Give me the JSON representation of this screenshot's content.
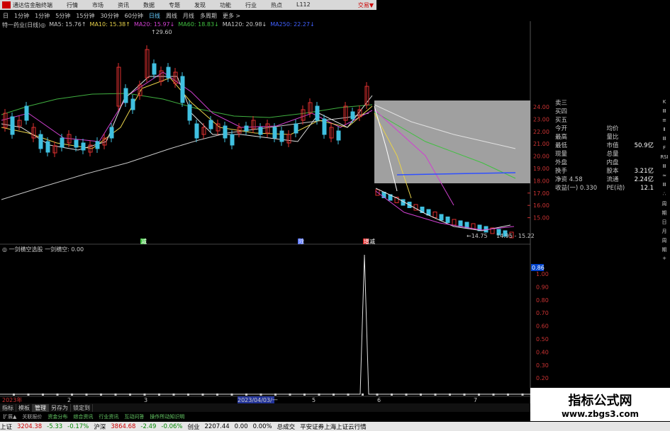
{
  "titlebar": {
    "app": "通达信金融终端",
    "menus": [
      "行情",
      "市场",
      "资讯",
      "数据",
      "专题",
      "发现",
      "功能",
      "行业",
      "热点",
      "L112"
    ],
    "right": "交易▼"
  },
  "periods": [
    "日",
    "1分钟",
    "1分钟",
    "5分钟",
    "15分钟",
    "30分钟",
    "60分钟",
    "日线",
    "周线",
    "月线",
    "多周期",
    "更多 >"
  ],
  "ma_legend": [
    {
      "text": "特一药业(日线)◎",
      "color": "#c8c8c8"
    },
    {
      "text": "MA5: 15.76↑",
      "color": "#c8c8c8"
    },
    {
      "text": "MA10: 15.38↑",
      "color": "#e8d24a"
    },
    {
      "text": "MA20: 15.97↓",
      "color": "#d040d0"
    },
    {
      "text": "MA60: 18.83↓",
      "color": "#40c040"
    },
    {
      "text": "MA120: 20.98↓",
      "color": "#c8c8c8"
    },
    {
      "text": "MA250: 22.27↓",
      "color": "#4060ff"
    }
  ],
  "chart": {
    "high_label": "29.60",
    "low_label": "14.75",
    "last_labels": "14.95 - 15.22",
    "price_ticks": [
      "24.00",
      "23.00",
      "22.00",
      "21.00",
      "20.00",
      "19.00",
      "18.00",
      "17.00",
      "16.00",
      "15.00"
    ],
    "osc_ticks": [
      "1.00",
      "0.90",
      "0.80",
      "0.70",
      "0.60",
      "0.50",
      "0.40",
      "0.30",
      "0.20",
      "0.10"
    ],
    "osc_marker": "0.86",
    "date_labels": [
      "2023年",
      "2",
      "3",
      "2023/04/03/一",
      "5",
      "6",
      "7"
    ],
    "bottom_markers": [
      "减",
      "除",
      "增减"
    ]
  },
  "info": [
    [
      "卖三",
      "",
      ""
    ],
    [
      "买四",
      "",
      ""
    ],
    [
      "买五",
      "",
      ""
    ],
    [
      "今开",
      "均价",
      ""
    ],
    [
      "最高",
      "量比",
      ""
    ],
    [
      "最低",
      "市值",
      "50.9亿"
    ],
    [
      "现量",
      "总量",
      ""
    ],
    [
      "外盘",
      "内盘",
      ""
    ],
    [
      "换手",
      "股本",
      "3.21亿"
    ],
    [
      "净资 4.58",
      "流通",
      "2.24亿"
    ],
    [
      "收益(一) 0.330",
      "PE(动)",
      "12.1"
    ]
  ],
  "right_toolbar": [
    "K",
    "Ⅲ",
    "≡",
    "Ⅱ",
    "Ⅲ",
    "F",
    "RSI",
    "Ⅲ",
    "≈",
    "Ⅲ",
    "∴",
    "周",
    "期",
    "日",
    "月",
    "周",
    "期",
    "+"
  ],
  "indicator": {
    "name": "一剑横空选股",
    "value_label": "一剑横空: 0.00"
  },
  "tabs": [
    "指标",
    "模板",
    "管理",
    "另存为",
    "锁定到"
  ],
  "tabs2": [
    "扩展▲",
    "关联报价",
    "资金分布",
    "综合资讯",
    "行业资讯",
    "互动问答",
    "操作所动知识明"
  ],
  "status": [
    {
      "t": "上证",
      "c": ""
    },
    {
      "t": "3204.38",
      "c": "up"
    },
    {
      "t": "-5.33",
      "c": "dn"
    },
    {
      "t": "-0.17%",
      "c": "dn"
    },
    {
      "t": "沪深",
      "c": ""
    },
    {
      "t": "3864.68",
      "c": "up"
    },
    {
      "t": "-2.49",
      "c": "dn"
    },
    {
      "t": "-0.06%",
      "c": "dn"
    },
    {
      "t": "创业",
      "c": ""
    },
    {
      "t": "2207.44",
      "c": ""
    },
    {
      "t": "0.00",
      "c": ""
    },
    {
      "t": "0.00%",
      "c": ""
    },
    {
      "t": "总成交",
      "c": ""
    },
    {
      "t": "平安证券上海上证云行情",
      "c": ""
    }
  ],
  "watermark": {
    "line1": "指标公式网",
    "line2": "www.zbgs3.com"
  }
}
